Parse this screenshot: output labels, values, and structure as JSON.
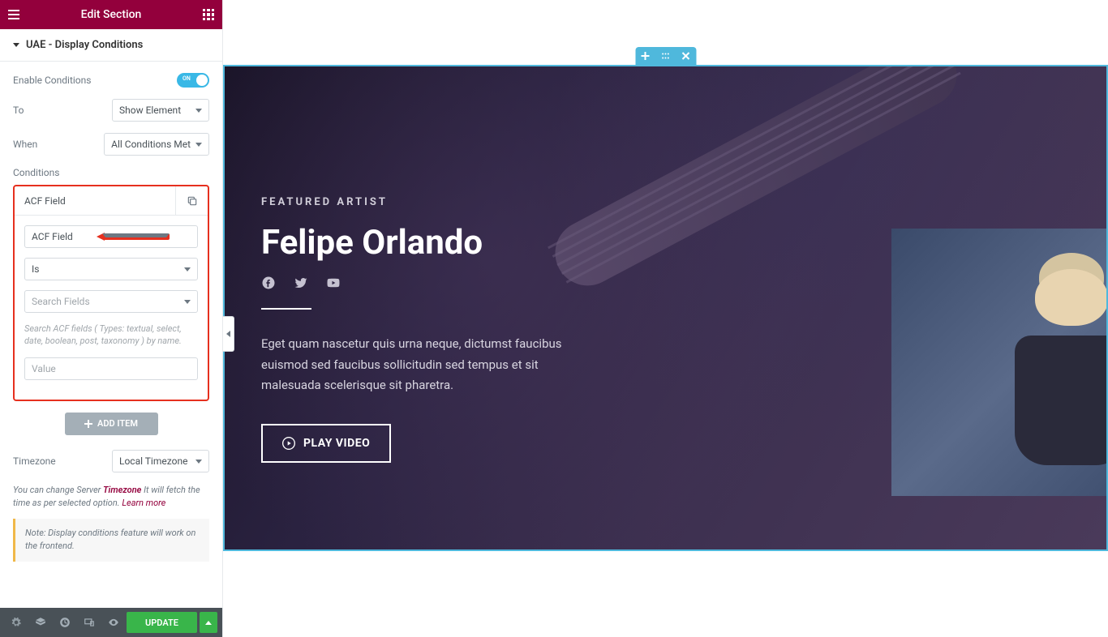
{
  "header": {
    "title": "Edit Section"
  },
  "section": {
    "title": "UAE - Display Conditions"
  },
  "controls": {
    "enable_label": "Enable Conditions",
    "toggle_on": "ON",
    "to_label": "To",
    "to_value": "Show Element",
    "when_label": "When",
    "when_value": "All Conditions Met",
    "conditions_label": "Conditions"
  },
  "condition": {
    "header": "ACF Field",
    "field1": "ACF Field",
    "field2": "Is",
    "field3_placeholder": "Search Fields",
    "help": "Search ACF fields ( Types: textual, select, date, boolean, post, taxonomy ) by name.",
    "value_placeholder": "Value"
  },
  "add_item": "ADD ITEM",
  "timezone": {
    "label": "Timezone",
    "value": "Local Timezone",
    "note_pre": "You can change Server ",
    "note_link": "Timezone",
    "note_mid": " It will fetch the time as per selected option. ",
    "note_learn": "Learn more"
  },
  "notice": "Note: Display conditions feature will work on the frontend.",
  "footer": {
    "update": "UPDATE"
  },
  "hero": {
    "overline": "FEATURED ARTIST",
    "title": "Felipe Orlando",
    "desc": "Eget quam nascetur quis urna neque, dictumst faucibus euismod sed faucibus sollicitudin sed tempus et sit malesuada scelerisque sit pharetra.",
    "play": "PLAY VIDEO"
  }
}
